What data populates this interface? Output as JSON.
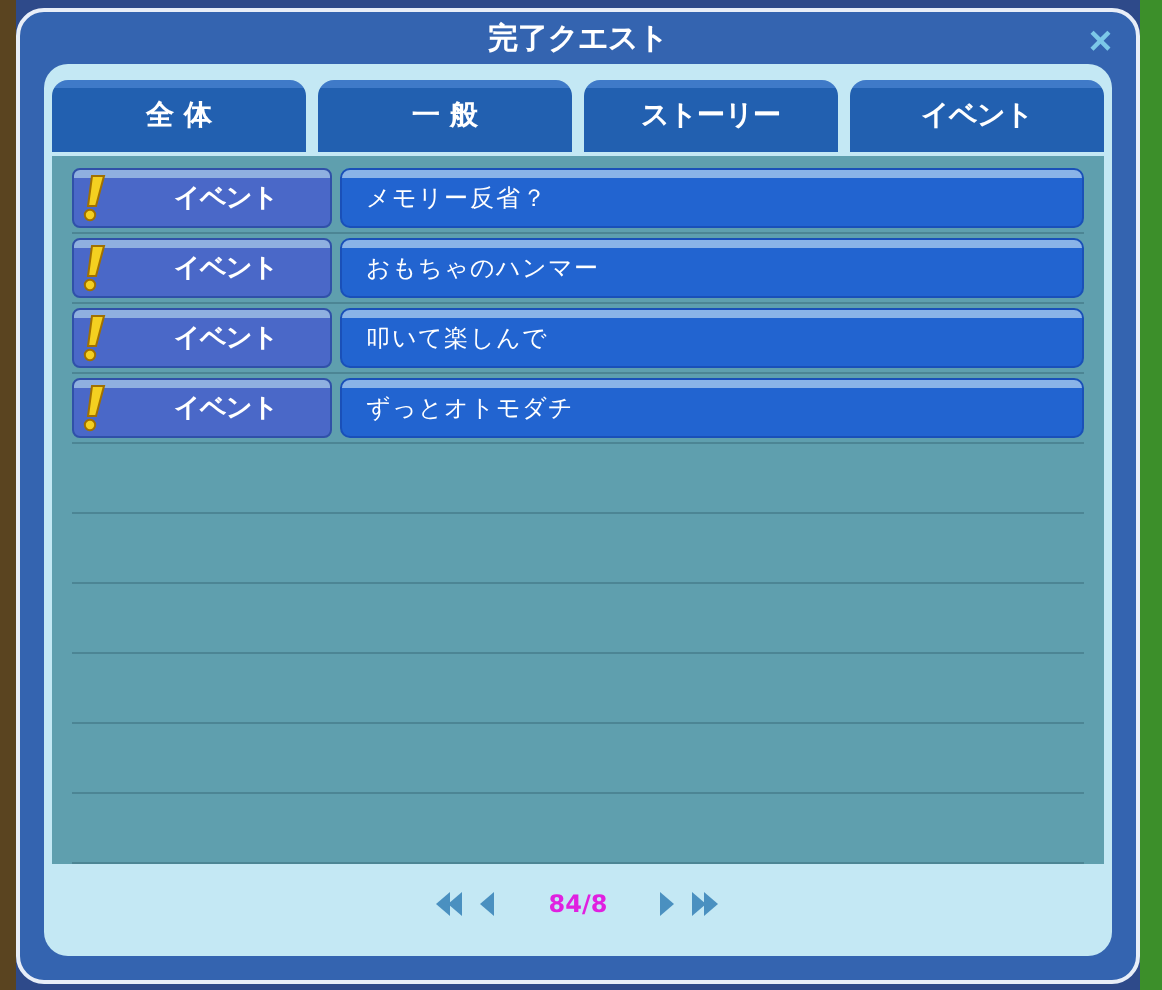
{
  "window": {
    "title": "完了クエスト",
    "close": "×"
  },
  "tabs": [
    {
      "label": "全 体"
    },
    {
      "label": "一 般"
    },
    {
      "label": "ストーリー"
    },
    {
      "label": "イベント"
    }
  ],
  "quests": [
    {
      "kind": "event",
      "category": "イベント",
      "title": "メモリー反省？"
    },
    {
      "kind": "event",
      "category": "イベント",
      "title": "おもちゃのハンマー"
    },
    {
      "kind": "event",
      "category": "イベント",
      "title": "叩いて楽しんで"
    },
    {
      "kind": "event",
      "category": "イベント",
      "title": "ずっとオトモダチ"
    }
  ],
  "pager": {
    "page": "84/8"
  }
}
